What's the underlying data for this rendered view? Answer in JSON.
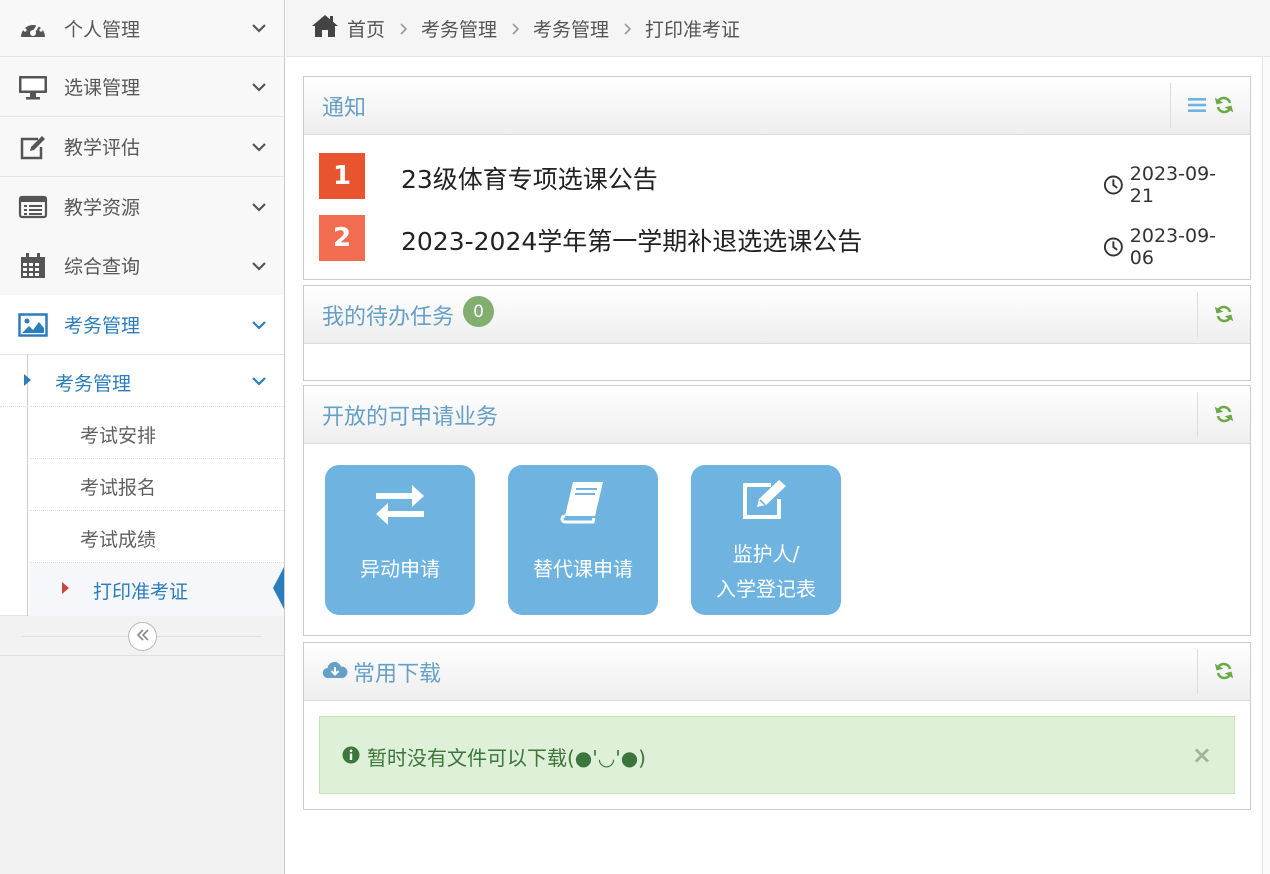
{
  "sidebar": {
    "items": [
      {
        "label": "个人管理",
        "icon": "dashboard-icon"
      },
      {
        "label": "选课管理",
        "icon": "desktop-icon"
      },
      {
        "label": "教学评估",
        "icon": "edit-icon"
      },
      {
        "label": "教学资源",
        "icon": "list-icon"
      },
      {
        "label": "综合查询",
        "icon": "calendar-icon"
      },
      {
        "label": "考务管理",
        "icon": "picture-icon"
      }
    ],
    "submenu": {
      "parent_label": "考务管理",
      "children": [
        "考试安排",
        "考试报名",
        "考试成绩",
        "打印准考证"
      ]
    },
    "collapse_icon": "double-chevron-left-icon"
  },
  "breadcrumb": {
    "items": [
      "首页",
      "考务管理",
      "考务管理",
      "打印准考证"
    ]
  },
  "notice": {
    "title": "通知",
    "items": [
      {
        "rank": "1",
        "title": "23级体育专项选课公告",
        "date": "2023-09-21",
        "rank_color": "#e8542f"
      },
      {
        "rank": "2",
        "title": "2023-2024学年第一学期补退选选课公告",
        "date": "2023-09-06",
        "rank_color": "#f26d50"
      }
    ]
  },
  "tasks": {
    "title": "我的待办任务",
    "count": "0"
  },
  "apply": {
    "title": "开放的可申请业务",
    "buttons": [
      {
        "label": "异动申请",
        "icon": "exchange-icon"
      },
      {
        "label": "替代课申请",
        "icon": "book-icon"
      },
      {
        "label_line1": "监护人/",
        "label_line2": "入学登记表",
        "icon": "edit-icon"
      }
    ]
  },
  "downloads": {
    "title": "常用下载",
    "empty_message": "暂时没有文件可以下载(●'◡'●)",
    "close_symbol": "×"
  },
  "colors": {
    "accent": "#2b7dbc",
    "widget_title": "#669fc7",
    "refresh": "#69aa46",
    "tile": "#6fb3e0",
    "success_bg": "#dff0d8"
  }
}
